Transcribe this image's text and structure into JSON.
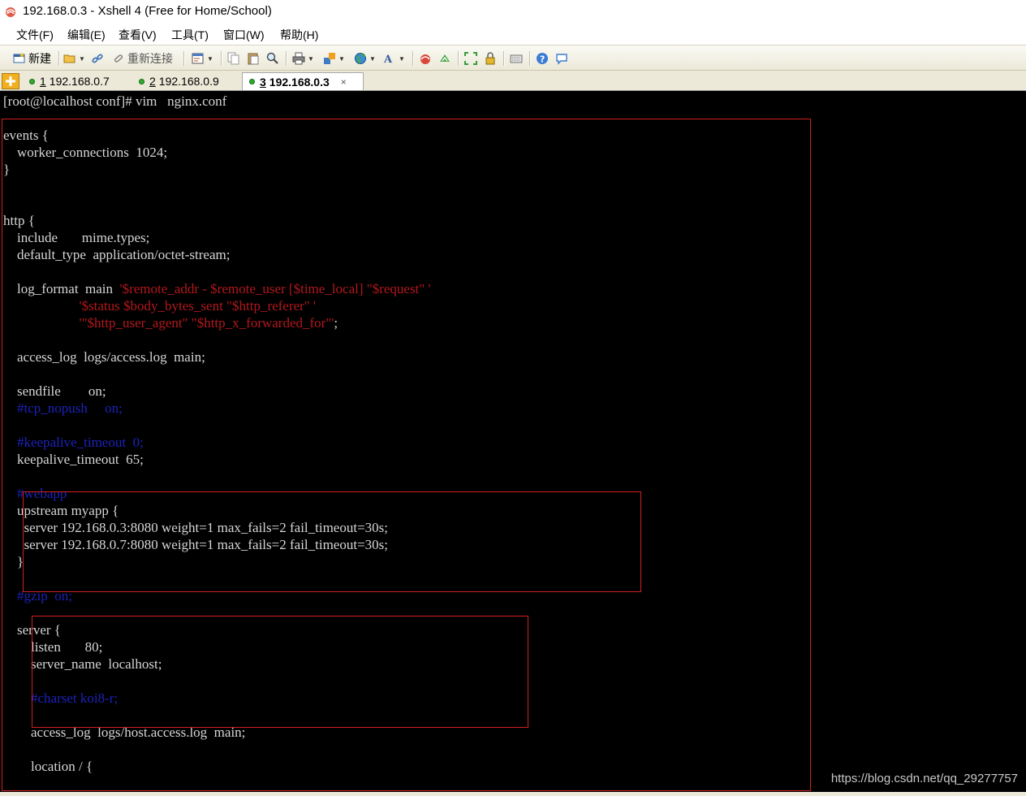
{
  "window": {
    "title": "192.168.0.3 - Xshell 4 (Free for Home/School)"
  },
  "menu": [
    "文件(F)",
    "编辑(E)",
    "查看(V)",
    "工具(T)",
    "窗口(W)",
    "帮助(H)"
  ],
  "toolbar": {
    "new_label": "新建",
    "reconnect_label": "重新连接"
  },
  "tabs": [
    {
      "num": "1",
      "label": "192.168.0.7",
      "active": false
    },
    {
      "num": "2",
      "label": "192.168.0.9",
      "active": false
    },
    {
      "num": "3",
      "label": "192.168.0.3",
      "active": true,
      "close": "×"
    }
  ],
  "colors": {
    "terminal_bg": "#000000",
    "text": "#d6d6d6",
    "string_red": "#b3171c",
    "comment_blue": "#1c22b8",
    "highlight_box": "#d22020"
  },
  "terminal": {
    "prompt_line": "[root@localhost conf]# vim   nginx.conf",
    "lines": [
      {
        "kind": "n",
        "parts": [
          "events {"
        ]
      },
      {
        "kind": "n",
        "parts": [
          "    worker_connections  1024;"
        ]
      },
      {
        "kind": "n",
        "parts": [
          "}"
        ]
      },
      {
        "kind": "n",
        "parts": [
          ""
        ]
      },
      {
        "kind": "n",
        "parts": [
          ""
        ]
      },
      {
        "kind": "n",
        "parts": [
          "http {"
        ]
      },
      {
        "kind": "n",
        "parts": [
          "    include       mime.types;"
        ]
      },
      {
        "kind": "n",
        "parts": [
          "    default_type  application/octet-stream;"
        ]
      },
      {
        "kind": "n",
        "parts": [
          ""
        ]
      },
      {
        "kind": "s",
        "parts": [
          "    log_format  main  ",
          "'$remote_addr - $remote_user [$time_local] \"$request\" '"
        ]
      },
      {
        "kind": "s",
        "parts": [
          "                      ",
          "'$status $body_bytes_sent \"$http_referer\" '"
        ]
      },
      {
        "kind": "s",
        "parts": [
          "                      ",
          "'\"$http_user_agent\" \"$http_x_forwarded_for\"'",
          ";"
        ]
      },
      {
        "kind": "n",
        "parts": [
          ""
        ]
      },
      {
        "kind": "n",
        "parts": [
          "    access_log  logs/access.log  main;"
        ]
      },
      {
        "kind": "n",
        "parts": [
          ""
        ]
      },
      {
        "kind": "n",
        "parts": [
          "    sendfile        on;"
        ]
      },
      {
        "kind": "c",
        "parts": [
          "    #tcp_nopush     on;"
        ]
      },
      {
        "kind": "n",
        "parts": [
          ""
        ]
      },
      {
        "kind": "c",
        "parts": [
          "    #keepalive_timeout  0;"
        ]
      },
      {
        "kind": "n",
        "parts": [
          "    keepalive_timeout  65;"
        ]
      },
      {
        "kind": "n",
        "parts": [
          ""
        ]
      },
      {
        "kind": "c",
        "parts": [
          "    #webapp"
        ]
      },
      {
        "kind": "n",
        "parts": [
          "    upstream myapp {"
        ]
      },
      {
        "kind": "n",
        "parts": [
          "      server 192.168.0.3:8080 weight=1 max_fails=2 fail_timeout=30s;"
        ]
      },
      {
        "kind": "n",
        "parts": [
          "      server 192.168.0.7:8080 weight=1 max_fails=2 fail_timeout=30s;"
        ]
      },
      {
        "kind": "n",
        "parts": [
          "    }"
        ]
      },
      {
        "kind": "n",
        "parts": [
          ""
        ]
      },
      {
        "kind": "c",
        "parts": [
          "    #gzip  on;"
        ]
      },
      {
        "kind": "n",
        "parts": [
          ""
        ]
      },
      {
        "kind": "n",
        "parts": [
          "    server {"
        ]
      },
      {
        "kind": "n",
        "parts": [
          "        listen       80;"
        ]
      },
      {
        "kind": "n",
        "parts": [
          "        server_name  localhost;"
        ]
      },
      {
        "kind": "n",
        "parts": [
          ""
        ]
      },
      {
        "kind": "c",
        "parts": [
          "        #charset koi8-r;"
        ]
      },
      {
        "kind": "n",
        "parts": [
          ""
        ]
      },
      {
        "kind": "n",
        "parts": [
          "        access_log  logs/host.access.log  main;"
        ]
      },
      {
        "kind": "n",
        "parts": [
          ""
        ]
      },
      {
        "kind": "n",
        "parts": [
          "        location / {"
        ]
      }
    ]
  },
  "watermark": "https://blog.csdn.net/qq_29277757"
}
